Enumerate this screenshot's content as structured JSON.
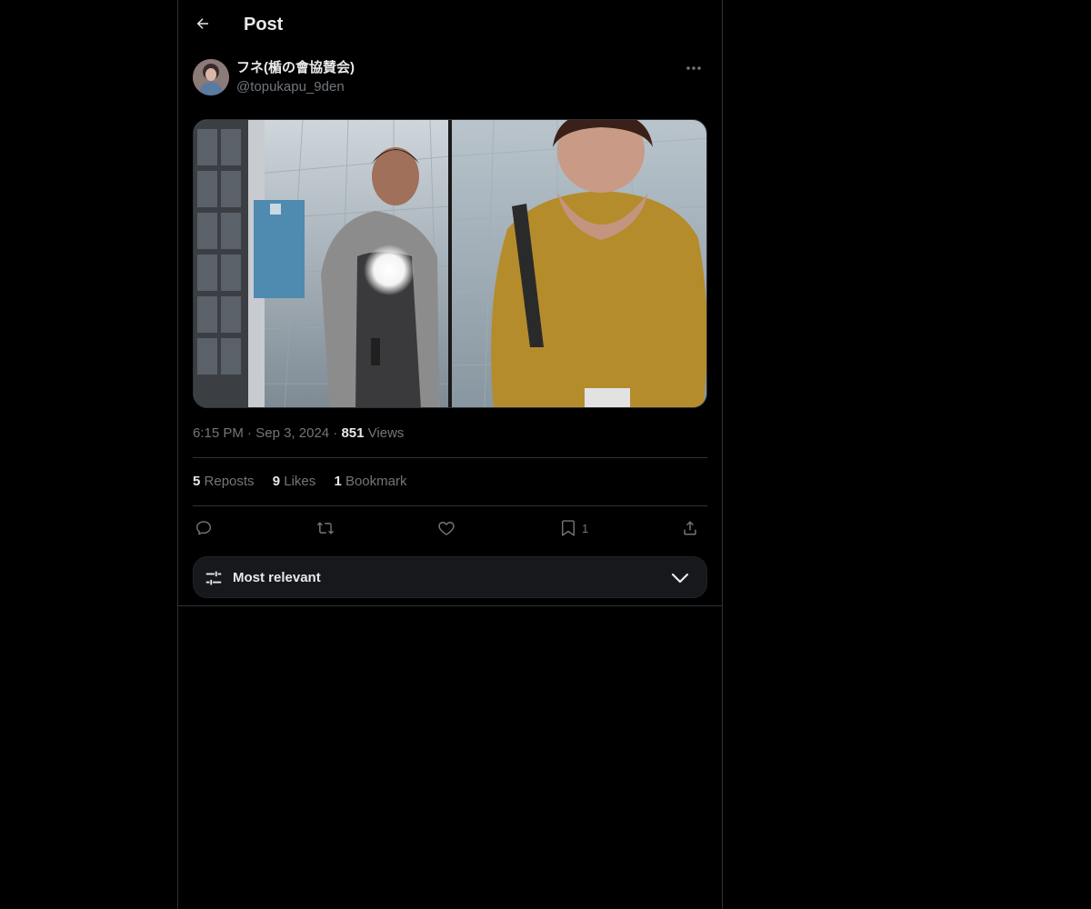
{
  "header": {
    "title": "Post",
    "back_icon": "arrow-left-icon"
  },
  "author": {
    "display_name": "フネ(楯の會協賛会)",
    "handle": "@topukapu_9den",
    "more_icon": "more-horizontal-icon"
  },
  "post": {
    "time": "6:15 PM",
    "date": "Sep 3, 2024",
    "separator": "·",
    "views_count": "851",
    "views_label": "Views"
  },
  "stats": {
    "reposts_count": "5",
    "reposts_label": "Reposts",
    "likes_count": "9",
    "likes_label": "Likes",
    "bookmarks_count": "1",
    "bookmarks_label": "Bookmark"
  },
  "actions": {
    "reply_icon": "reply-icon",
    "repost_icon": "repost-icon",
    "like_icon": "heart-icon",
    "bookmark_icon": "bookmark-icon",
    "bookmark_count": "1",
    "share_icon": "share-icon"
  },
  "sort": {
    "label": "Most relevant",
    "icon": "sliders-icon",
    "chevron": "chevron-down-icon"
  },
  "colors": {
    "background": "#000000",
    "text_primary": "#e7e9ea",
    "text_secondary": "#71767b",
    "border": "#2f3336",
    "sort_bar_bg": "#16181c"
  }
}
